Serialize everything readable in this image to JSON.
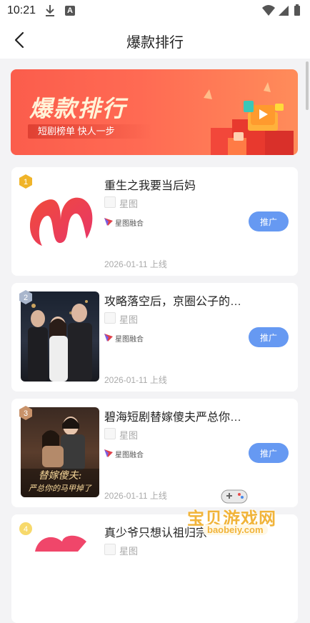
{
  "status_bar": {
    "time": "10:21"
  },
  "nav": {
    "title": "爆款排行"
  },
  "banner": {
    "title": "爆款排行",
    "subtitle": "短剧榜单 快人一步"
  },
  "items": [
    {
      "rank": "1",
      "title": "重生之我要当后妈",
      "platform": "星图",
      "brand": "星图融合",
      "button": "推广",
      "date": "2026-01-11 上线"
    },
    {
      "rank": "2",
      "title": "攻略落空后，京圈公子的…",
      "platform": "星图",
      "brand": "星图融合",
      "button": "推广",
      "date": "2026-01-11 上线"
    },
    {
      "rank": "3",
      "title": "碧海短剧替嫁傻夫严总你…",
      "platform": "星图",
      "brand": "星图融合",
      "button": "推广",
      "date": "2026-01-11 上线"
    },
    {
      "rank": "4",
      "title": "真少爷只想认祖归宗",
      "platform": "星图"
    }
  ],
  "poster_texts": {
    "item3": [
      "替嫁傻夫:",
      "严总你的马甲掉了"
    ]
  },
  "watermark": {
    "text": "宝贝游戏网",
    "sub": "baobeiy.com"
  },
  "colors": {
    "accent": "#6699f2",
    "banner": "#fb5d4c",
    "gold": "#f1b43a"
  }
}
